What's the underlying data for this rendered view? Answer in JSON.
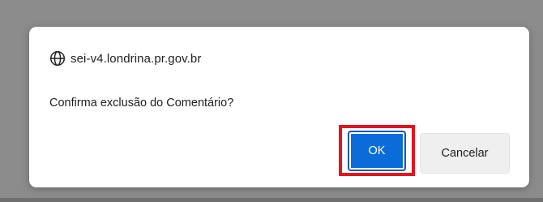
{
  "dialog": {
    "origin": "sei-v4.londrina.pr.gov.br",
    "origin_icon": "globe-icon",
    "message": "Confirma exclusão do Comentário?",
    "ok_label": "OK",
    "cancel_label": "Cancelar"
  },
  "colors": {
    "accent": "#0a6cd8",
    "highlight": "#e0141e",
    "backdrop": "#8c8c8c"
  }
}
